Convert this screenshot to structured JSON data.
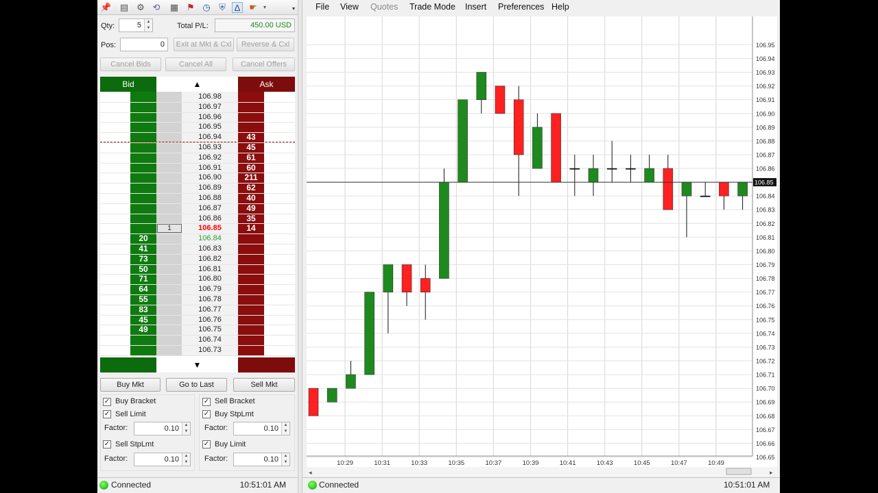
{
  "left": {
    "qty_label": "Qty:",
    "qty_value": "5",
    "total_pl_label": "Total P/L:",
    "total_pl_value": "450.00 USD",
    "pos_label": "Pos:",
    "pos_value": "0",
    "exit_button": "Exit at Mkt & Cxl",
    "reverse_button": "Reverse & Cxl",
    "cancel_bids_button": "Cancel Bids",
    "cancel_all_button": "Cancel All",
    "cancel_offers_button": "Cancel Offers",
    "bid_header": "Bid",
    "ask_header": "Ask",
    "ladder": {
      "prices": [
        "106.98",
        "106.97",
        "106.96",
        "106.95",
        "106.94",
        "106.93",
        "106.92",
        "106.91",
        "106.90",
        "106.89",
        "106.88",
        "106.87",
        "106.86",
        "106.85",
        "106.84",
        "106.83",
        "106.82",
        "106.81",
        "106.80",
        "106.79",
        "106.78",
        "106.77",
        "106.76",
        "106.75",
        "106.74",
        "106.73"
      ],
      "ask_qty": [
        "",
        "",
        "",
        "",
        "43",
        "45",
        "61",
        "60",
        "211",
        "62",
        "40",
        "49",
        "35",
        "14",
        "",
        "",
        "",
        "",
        "",
        "",
        "",
        "",
        "",
        "",
        "",
        ""
      ],
      "bid_qty": [
        "",
        "",
        "",
        "",
        "",
        "",
        "",
        "",
        "",
        "",
        "",
        "",
        "",
        "",
        "20",
        "41",
        "73",
        "50",
        "71",
        "64",
        "55",
        "83",
        "45",
        "49",
        "",
        ""
      ],
      "my_orders": [
        "",
        "",
        "",
        "",
        "",
        "",
        "",
        "",
        "",
        "",
        "",
        "",
        "",
        "1",
        "",
        "",
        "",
        "",
        "",
        "",
        "",
        "",
        "",
        "",
        "",
        ""
      ],
      "last_price_index": 13,
      "last_bid_index": 14
    },
    "buy_mkt_button": "Buy Mkt",
    "go_to_last_button": "Go to Last",
    "sell_mkt_button": "Sell Mkt",
    "buy_bracket": "Buy Bracket",
    "sell_limit": "Sell Limit",
    "sell_bracket": "Sell Bracket",
    "buy_stplmt": "Buy StpLmt",
    "factor_label": "Factor:",
    "factor_1": "0.10",
    "factor_2": "0.10",
    "sell_stplmt": "Sell StpLmt",
    "buy_limit": "Buy Limit",
    "factor_3": "0.10",
    "factor_4": "0.10",
    "status": "Connected",
    "time": "10:51:01 AM"
  },
  "right": {
    "menu": {
      "file": "File",
      "view": "View",
      "quotes": "Quotes",
      "trade_mode": "Trade Mode",
      "insert": "Insert",
      "preferences": "Preferences",
      "help": "Help"
    },
    "status": "Connected",
    "time": "10:51:01 AM"
  },
  "colors": {
    "up": "#1e8a1e",
    "down": "#ff2020",
    "bid": "#0b7a0b",
    "ask": "#8b0d0d",
    "last": "#ff0000"
  },
  "chart_data": {
    "type": "candlestick",
    "y_tick_labels": [
      "106.95",
      "106.94",
      "106.93",
      "106.92",
      "106.91",
      "106.90",
      "106.89",
      "106.88",
      "106.87",
      "106.86",
      "106.85",
      "106.84",
      "106.83",
      "106.82",
      "106.81",
      "106.80",
      "106.79",
      "106.78",
      "106.77",
      "106.76",
      "106.75",
      "106.74",
      "106.73",
      "106.72",
      "106.71",
      "106.70",
      "106.69",
      "106.68",
      "106.67",
      "106.66",
      "106.65"
    ],
    "x_tick_labels": [
      "10:29",
      "10:31",
      "10:33",
      "10:35",
      "10:37",
      "10:39",
      "10:41",
      "10:43",
      "10:45",
      "10:47",
      "10:49"
    ],
    "last_price_label": "106.85",
    "last_price": 106.85,
    "ylim": [
      106.645,
      106.955
    ],
    "candles": [
      {
        "o": 106.7,
        "h": 106.7,
        "l": 106.68,
        "c": 106.68
      },
      {
        "o": 106.69,
        "h": 106.7,
        "l": 106.69,
        "c": 106.7
      },
      {
        "o": 106.7,
        "h": 106.72,
        "l": 106.7,
        "c": 106.71
      },
      {
        "o": 106.71,
        "h": 106.77,
        "l": 106.71,
        "c": 106.77
      },
      {
        "o": 106.77,
        "h": 106.79,
        "l": 106.74,
        "c": 106.79
      },
      {
        "o": 106.79,
        "h": 106.79,
        "l": 106.76,
        "c": 106.77
      },
      {
        "o": 106.78,
        "h": 106.79,
        "l": 106.75,
        "c": 106.77
      },
      {
        "o": 106.78,
        "h": 106.86,
        "l": 106.78,
        "c": 106.85
      },
      {
        "o": 106.85,
        "h": 106.91,
        "l": 106.85,
        "c": 106.91
      },
      {
        "o": 106.91,
        "h": 106.93,
        "l": 106.9,
        "c": 106.93
      },
      {
        "o": 106.92,
        "h": 106.92,
        "l": 106.9,
        "c": 106.9
      },
      {
        "o": 106.91,
        "h": 106.92,
        "l": 106.84,
        "c": 106.87
      },
      {
        "o": 106.86,
        "h": 106.9,
        "l": 106.86,
        "c": 106.89
      },
      {
        "o": 106.9,
        "h": 106.9,
        "l": 106.85,
        "c": 106.85
      },
      {
        "o": 106.86,
        "h": 106.87,
        "l": 106.84,
        "c": 106.86
      },
      {
        "o": 106.85,
        "h": 106.87,
        "l": 106.84,
        "c": 106.86
      },
      {
        "o": 106.86,
        "h": 106.88,
        "l": 106.85,
        "c": 106.86
      },
      {
        "o": 106.86,
        "h": 106.87,
        "l": 106.85,
        "c": 106.86
      },
      {
        "o": 106.85,
        "h": 106.87,
        "l": 106.85,
        "c": 106.86
      },
      {
        "o": 106.86,
        "h": 106.87,
        "l": 106.83,
        "c": 106.83
      },
      {
        "o": 106.84,
        "h": 106.85,
        "l": 106.81,
        "c": 106.85
      },
      {
        "o": 106.84,
        "h": 106.85,
        "l": 106.84,
        "c": 106.84
      },
      {
        "o": 106.85,
        "h": 106.85,
        "l": 106.83,
        "c": 106.84
      },
      {
        "o": 106.84,
        "h": 106.85,
        "l": 106.83,
        "c": 106.85
      }
    ]
  }
}
